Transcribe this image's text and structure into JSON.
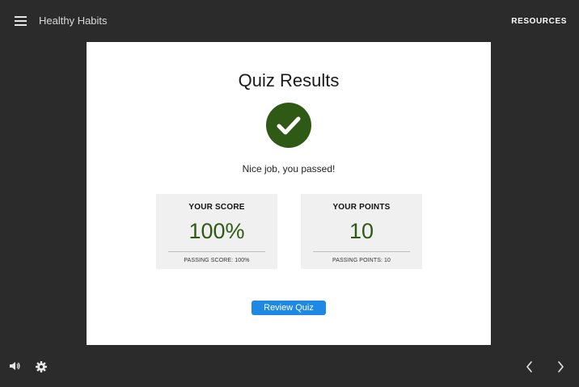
{
  "header": {
    "course_title": "Healthy Habits",
    "resources_label": "RESOURCES"
  },
  "quiz": {
    "title": "Quiz Results",
    "message": "Nice job, you passed!",
    "score_card": {
      "label": "YOUR SCORE",
      "value": "100%",
      "sub": "PASSING SCORE: 100%"
    },
    "points_card": {
      "label": "YOUR POINTS",
      "value": "10",
      "sub": "PASSING POINTS: 10"
    },
    "review_button_label": "Review Quiz"
  },
  "icons": {
    "menu": "hamburger-menu-icon",
    "status": "checkmark-icon",
    "audio": "speaker-icon",
    "settings": "gear-icon",
    "prev": "chevron-left-icon",
    "next": "chevron-right-icon"
  },
  "colors": {
    "background": "#2b2b2b",
    "slide": "#ffffff",
    "success": "#2e5a16",
    "button": "#1e88e5",
    "card": "#f0f0f0"
  }
}
